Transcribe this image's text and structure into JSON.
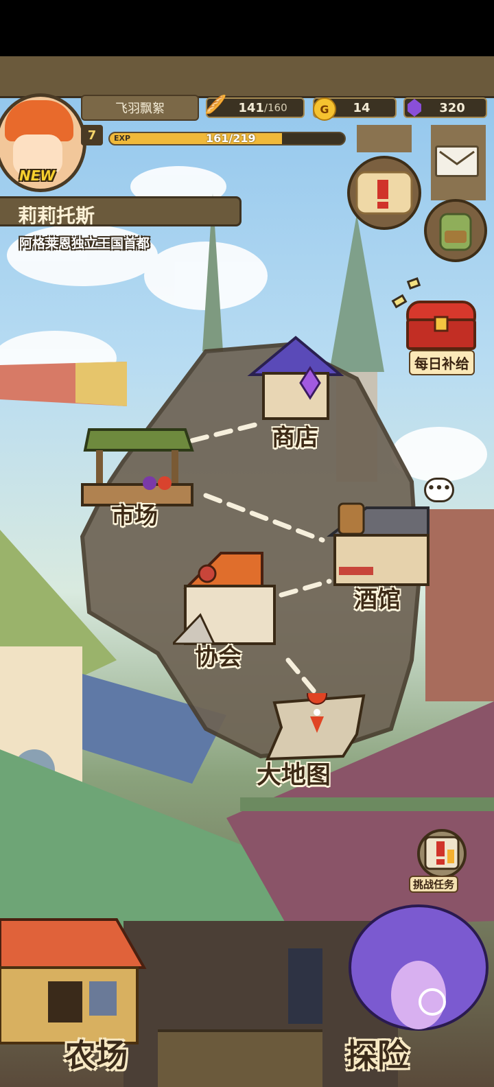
{
  "player": {
    "name": "飞羽飘絮",
    "level": "7",
    "new_badge": "NEW",
    "exp_label": "EXP",
    "exp_text": "161/219",
    "exp_progress": 0.735
  },
  "resources": {
    "bread_current": "141",
    "bread_max": "/160",
    "gold_icon": "G",
    "gold": "14",
    "gems": "320"
  },
  "location": {
    "city": "莉莉托斯",
    "subtitle": "阿格莱恩独立王国首都"
  },
  "side_buttons": {
    "daily_supply": "每日补给",
    "challenge_quest": "挑战任务"
  },
  "map_nodes": {
    "shop": "商店",
    "market": "市场",
    "tavern": "酒馆",
    "guild": "协会",
    "world_map": "大地图"
  },
  "bottom_nav": {
    "farm": "农场",
    "explore": "探险"
  },
  "colors": {
    "panel_brown": "#6b5a3c",
    "exp_fill": "#f0b93a",
    "gem_purple": "#8a4fd8"
  }
}
